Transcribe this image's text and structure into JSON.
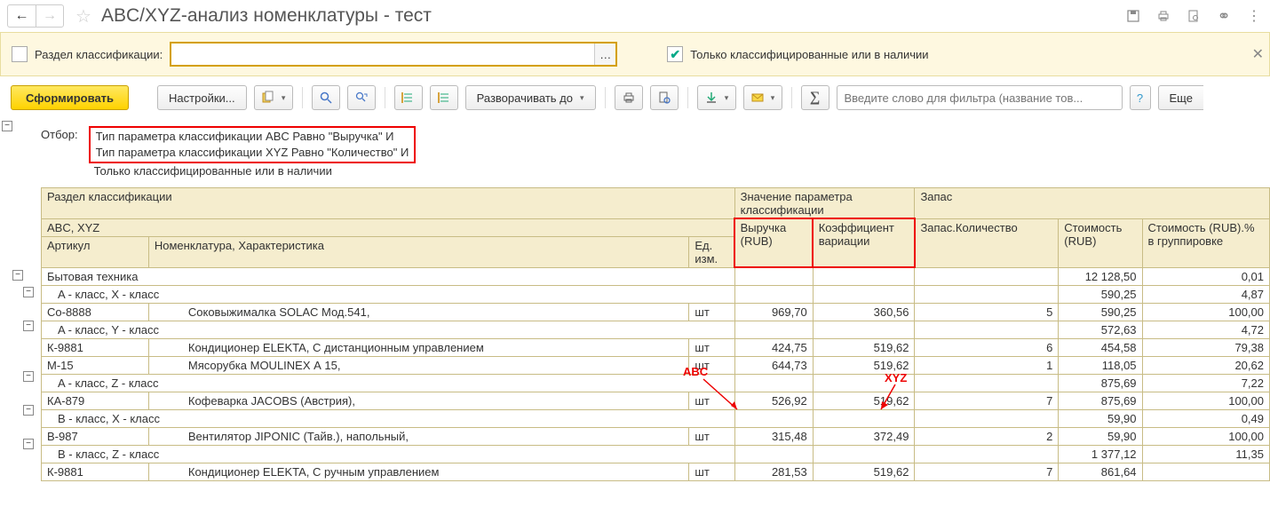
{
  "title": "ABC/XYZ-анализ номенклатуры - тест",
  "filter_bar": {
    "section_label": "Раздел классификации:",
    "only_classified_label": "Только классифицированные или в наличии"
  },
  "toolbar": {
    "generate": "Сформировать",
    "settings": "Настройки...",
    "expand_to": "Разворачивать до",
    "search_placeholder": "Введите слово для фильтра (название тов...",
    "more": "Еще"
  },
  "filter_info": {
    "label": "Отбор:",
    "line1": "Тип параметра классификации ABC Равно \"Выручка\" И",
    "line2": "Тип параметра классификации XYZ Равно \"Количество\" И",
    "line3": "Только классифицированные или в наличии"
  },
  "annotations": {
    "abc": "ABC",
    "xyz": "XYZ"
  },
  "headers": {
    "section": "Раздел классификации",
    "param_value": "Значение параметра классификации",
    "stock": "Запас",
    "abc_xyz": "ABC, XYZ",
    "revenue": "Выручка (RUB)",
    "variation": "Коэффициент вариации",
    "stock_qty": "Запас.Количество",
    "cost": "Стоимость (RUB)",
    "cost_pct": "Стоимость (RUB).% в группировке",
    "article": "Артикул",
    "nomenclature": "Номенклатура, Характеристика",
    "unit": "Ед. изм."
  },
  "rows": [
    {
      "type": "g0",
      "name": "Бытовая техника",
      "cost": "12 128,50",
      "pct": "0,01"
    },
    {
      "type": "g1",
      "name": "A - класс, X - класс",
      "cost": "590,25",
      "pct": "4,87"
    },
    {
      "type": "item",
      "art": "Со-8888",
      "name": "Соковыжималка  SOLAC  Мод.541,",
      "unit": "шт",
      "rev": "969,70",
      "var": "360,56",
      "qty": "5",
      "cost": "590,25",
      "pct": "100,00"
    },
    {
      "type": "g1",
      "name": "A - класс, Y - класс",
      "cost": "572,63",
      "pct": "4,72"
    },
    {
      "type": "item",
      "art": "К-9881",
      "name": "Кондиционер ELEKTA, С дистанционным управлением",
      "unit": "шт",
      "rev": "424,75",
      "var": "519,62",
      "qty": "6",
      "cost": "454,58",
      "pct": "79,38"
    },
    {
      "type": "item",
      "art": "М-15",
      "name": "Мясорубка MOULINEX  А 15,",
      "unit": "шт",
      "rev": "644,73",
      "var": "519,62",
      "qty": "1",
      "cost": "118,05",
      "pct": "20,62"
    },
    {
      "type": "g1",
      "name": "A - класс, Z - класс",
      "cost": "875,69",
      "pct": "7,22"
    },
    {
      "type": "item",
      "art": "КА-879",
      "name": "Кофеварка JACOBS (Австрия),",
      "unit": "шт",
      "rev": "526,92",
      "var": "519,62",
      "qty": "7",
      "cost": "875,69",
      "pct": "100,00"
    },
    {
      "type": "g1",
      "name": "B - класс, X - класс",
      "cost": "59,90",
      "pct": "0,49"
    },
    {
      "type": "item",
      "art": "В-987",
      "name": "Вентилятор JIPONIC (Тайв.), напольный,",
      "unit": "шт",
      "rev": "315,48",
      "var": "372,49",
      "qty": "2",
      "cost": "59,90",
      "pct": "100,00"
    },
    {
      "type": "g1",
      "name": "B - класс, Z - класс",
      "cost": "1 377,12",
      "pct": "11,35"
    },
    {
      "type": "item",
      "art": "К-9881",
      "name": "Кондиционер ELEKTA, С ручным управлением",
      "unit": "шт",
      "rev": "281,53",
      "var": "519,62",
      "qty": "7",
      "cost": "861,64",
      "pct": ""
    }
  ]
}
